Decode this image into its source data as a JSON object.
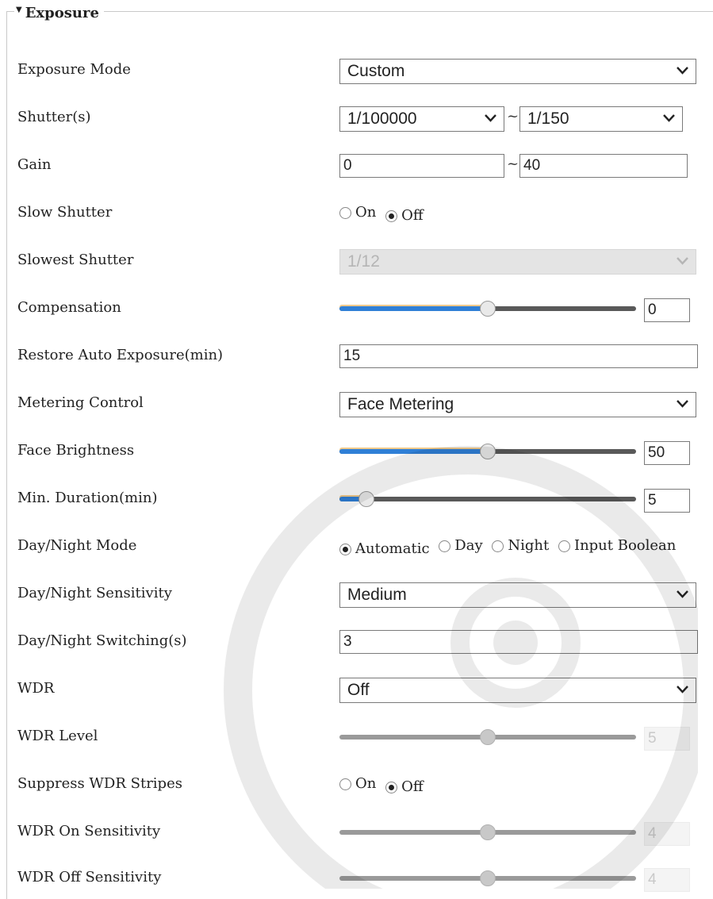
{
  "section": {
    "title": "Exposure"
  },
  "rows": {
    "exposure_mode": {
      "label": "Exposure Mode",
      "value": "Custom"
    },
    "shutter": {
      "label": "Shutter(s)",
      "min": "1/100000",
      "max": "1/150",
      "separator": "~"
    },
    "gain": {
      "label": "Gain",
      "min": "0",
      "max": "40",
      "separator": "~"
    },
    "slow_shutter": {
      "label": "Slow Shutter",
      "options": [
        "On",
        "Off"
      ],
      "selected": "Off"
    },
    "slowest_shutter": {
      "label": "Slowest Shutter",
      "value": "1/12",
      "disabled": true
    },
    "compensation": {
      "label": "Compensation",
      "value": "0",
      "fraction": 0.5
    },
    "restore_auto_exposure": {
      "label": "Restore Auto Exposure(min)",
      "value": "15"
    },
    "metering_control": {
      "label": "Metering Control",
      "value": "Face Metering"
    },
    "face_brightness": {
      "label": "Face Brightness",
      "value": "50",
      "fraction": 0.5
    },
    "min_duration": {
      "label": "Min. Duration(min)",
      "value": "5",
      "fraction": 0.09
    },
    "day_night_mode": {
      "label": "Day/Night Mode",
      "options": [
        "Automatic",
        "Day",
        "Night",
        "Input Boolean"
      ],
      "selected": "Automatic"
    },
    "day_night_sensitivity": {
      "label": "Day/Night Sensitivity",
      "value": "Medium"
    },
    "day_night_switching": {
      "label": "Day/Night Switching(s)",
      "value": "3"
    },
    "wdr": {
      "label": "WDR",
      "value": "Off"
    },
    "wdr_level": {
      "label": "WDR Level",
      "value": "5",
      "fraction": 0.5,
      "disabled": true
    },
    "suppress_wdr_stripes": {
      "label": "Suppress WDR Stripes",
      "options": [
        "On",
        "Off"
      ],
      "selected": "Off"
    },
    "wdr_on_sensitivity": {
      "label": "WDR On Sensitivity",
      "value": "4",
      "fraction": 0.5,
      "disabled": true
    },
    "wdr_off_sensitivity": {
      "label": "WDR Off Sensitivity",
      "value": "4",
      "fraction": 0.5,
      "disabled": true
    }
  },
  "colors": {
    "slider_fill": "#2f7fd6",
    "track": "#595959",
    "border": "#7a7a7a"
  }
}
